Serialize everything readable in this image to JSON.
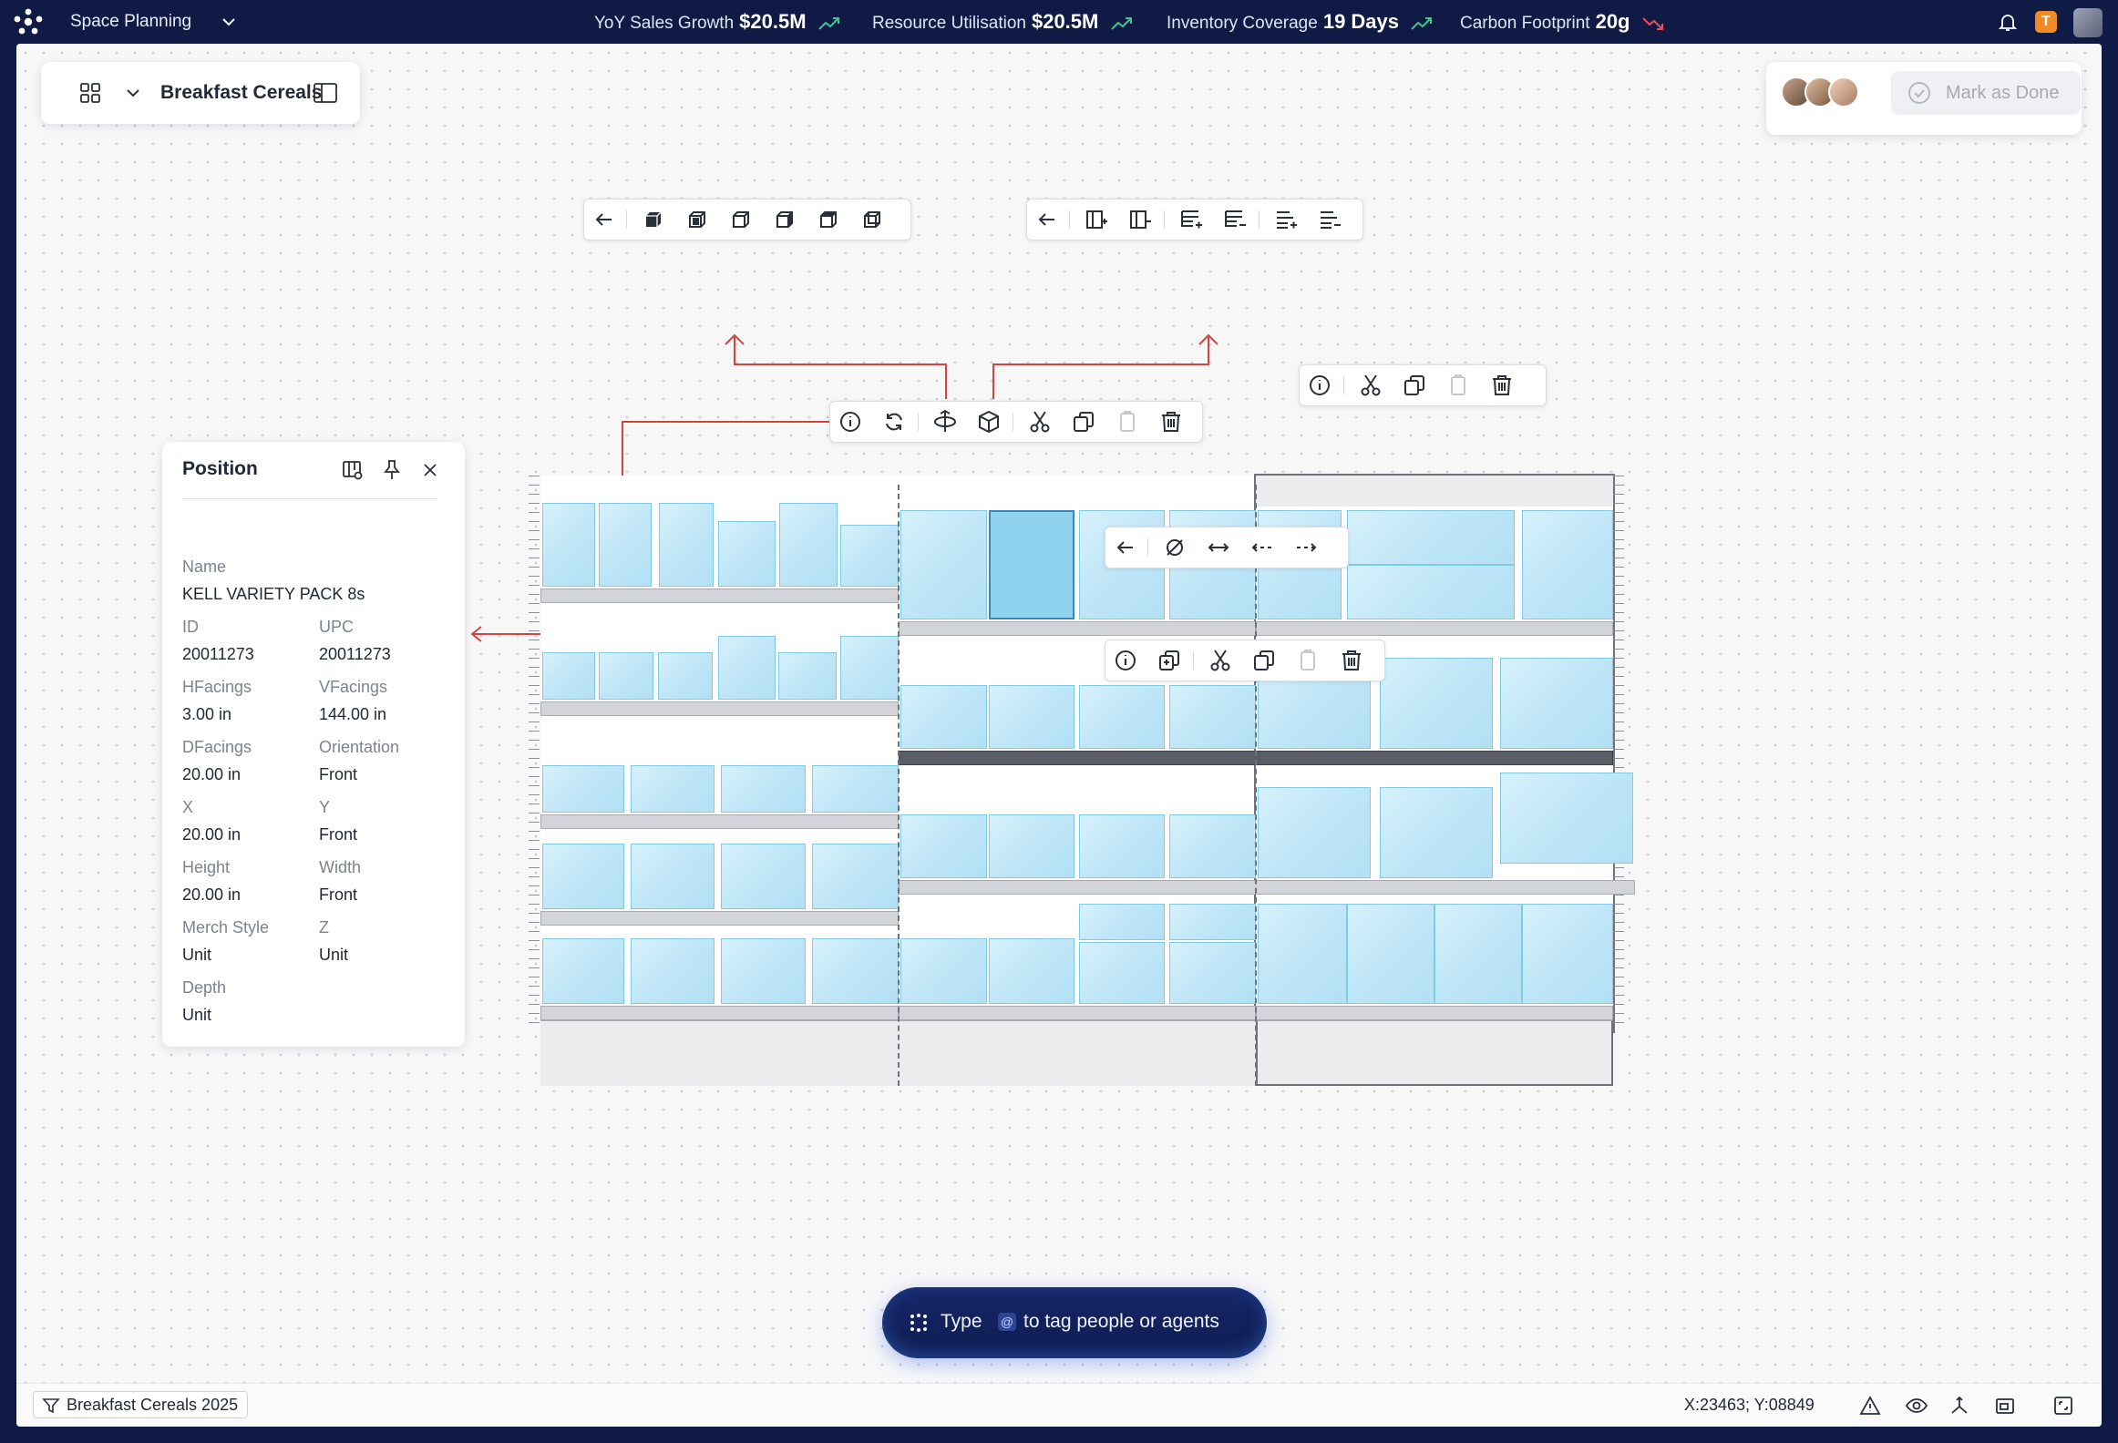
{
  "app": {
    "title": "Space Planning"
  },
  "kpis": [
    {
      "label": "YoY Sales Growth",
      "value": "$20.5M",
      "trend": "up"
    },
    {
      "label": "Resource Utilisation",
      "value": "$20.5M",
      "trend": "up"
    },
    {
      "label": "Inventory Coverage",
      "value": "19 Days",
      "trend": "up"
    },
    {
      "label": "Carbon Footprint",
      "value": "20g",
      "trend": "down"
    }
  ],
  "colors": {
    "trend_up": "#3ec48f",
    "trend_down": "#ef4b5a",
    "accent": "#0f1b45",
    "product": "#bfe6f7",
    "connector": "#d6453d"
  },
  "user": {
    "badge": "T"
  },
  "breadcrumb": {
    "title": "Breakfast Cereals"
  },
  "actions": {
    "mark_done": "Mark as Done"
  },
  "position_panel": {
    "title": "Position",
    "fields": [
      {
        "label": "Name",
        "value": "KELL VARIETY PACK 8s"
      },
      {
        "label": "ID",
        "value": "20011273"
      },
      {
        "label": "UPC",
        "value": "20011273"
      },
      {
        "label": "HFacings",
        "value": "3.00 in"
      },
      {
        "label": "VFacings",
        "value": "144.00 in"
      },
      {
        "label": "DFacings",
        "value": "20.00 in"
      },
      {
        "label": "Orientation",
        "value": "Front"
      },
      {
        "label": "X",
        "value": "20.00 in"
      },
      {
        "label": "Y",
        "value": "Front"
      },
      {
        "label": "Height",
        "value": "20.00 in"
      },
      {
        "label": "Width",
        "value": "Front"
      },
      {
        "label": "Merch Style",
        "value": "Unit"
      },
      {
        "label": "Z",
        "value": "Unit"
      },
      {
        "label": "Depth",
        "value": "Unit"
      }
    ]
  },
  "chat": {
    "prefix": "Type",
    "tag": "@",
    "suffix": "to tag people or agents"
  },
  "statusbar": {
    "filter": "Breakfast Cereals 2025",
    "coords": "X:23463; Y:08849"
  }
}
